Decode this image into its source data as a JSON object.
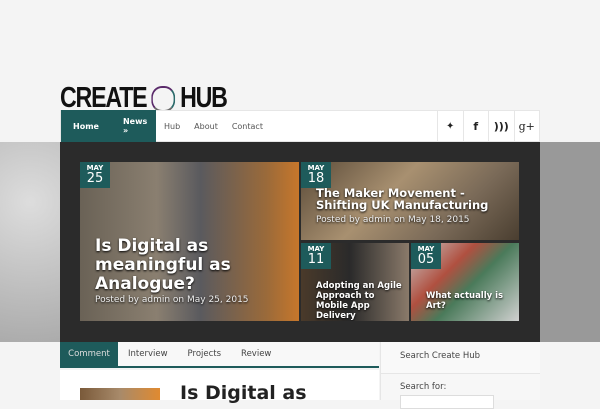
{
  "logo": {
    "left": "CREATE",
    "right": "HUB"
  },
  "nav": {
    "items": [
      "Home",
      "News »",
      "Hub",
      "About",
      "Contact"
    ]
  },
  "social": [
    "twitter-icon",
    "facebook-icon",
    "rss-icon",
    "google-plus-icon"
  ],
  "social_glyphs": [
    "🐦",
    "f",
    "◞",
    "g+"
  ],
  "slides": [
    {
      "month": "MAY",
      "day": "25",
      "title": "Is Digital as meaningful as Analogue?",
      "meta": "Posted by admin on May 25, 2015"
    },
    {
      "month": "MAY",
      "day": "18",
      "title": "The Maker Movement - Shifting UK Manufacturing",
      "meta": "Posted by admin on May 18, 2015"
    },
    {
      "month": "MAY",
      "day": "11",
      "title": "Adopting an Agile Approach to Mobile App Delivery"
    },
    {
      "month": "MAY",
      "day": "05",
      "title": "What actually is Art?"
    }
  ],
  "tabs": [
    "Comment",
    "Interview",
    "Projects",
    "Review"
  ],
  "post": {
    "title": "Is Digital as"
  },
  "sidebar": {
    "title": "Search Create Hub",
    "label": "Search for:",
    "value": ""
  }
}
